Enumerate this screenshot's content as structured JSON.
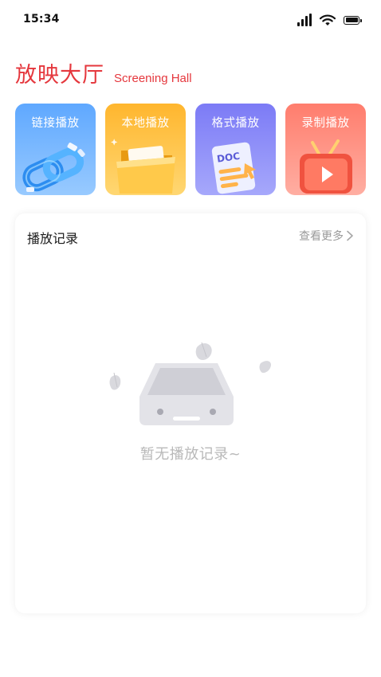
{
  "status_bar": {
    "time": "15:34",
    "icons": [
      "signal-icon",
      "wifi-icon",
      "battery-icon"
    ]
  },
  "header": {
    "title": "放映大厅",
    "subtitle": "Screening Hall",
    "accent_color": "#e5373d"
  },
  "cards": [
    {
      "label": "链接播放",
      "icon": "chain-link-icon",
      "color": "#5fa8ff"
    },
    {
      "label": "本地播放",
      "icon": "folder-icon",
      "color": "#ffb62e"
    },
    {
      "label": "格式播放",
      "icon": "doc-file-icon",
      "color": "#7c7bf6"
    },
    {
      "label": "录制播放",
      "icon": "tv-play-icon",
      "color": "#ff7d6d"
    }
  ],
  "format_card_doc_text": "DOC",
  "history": {
    "title": "播放记录",
    "view_more": "查看更多",
    "empty_text": "暂无播放记录~",
    "empty_icon": "empty-inbox-icon"
  }
}
